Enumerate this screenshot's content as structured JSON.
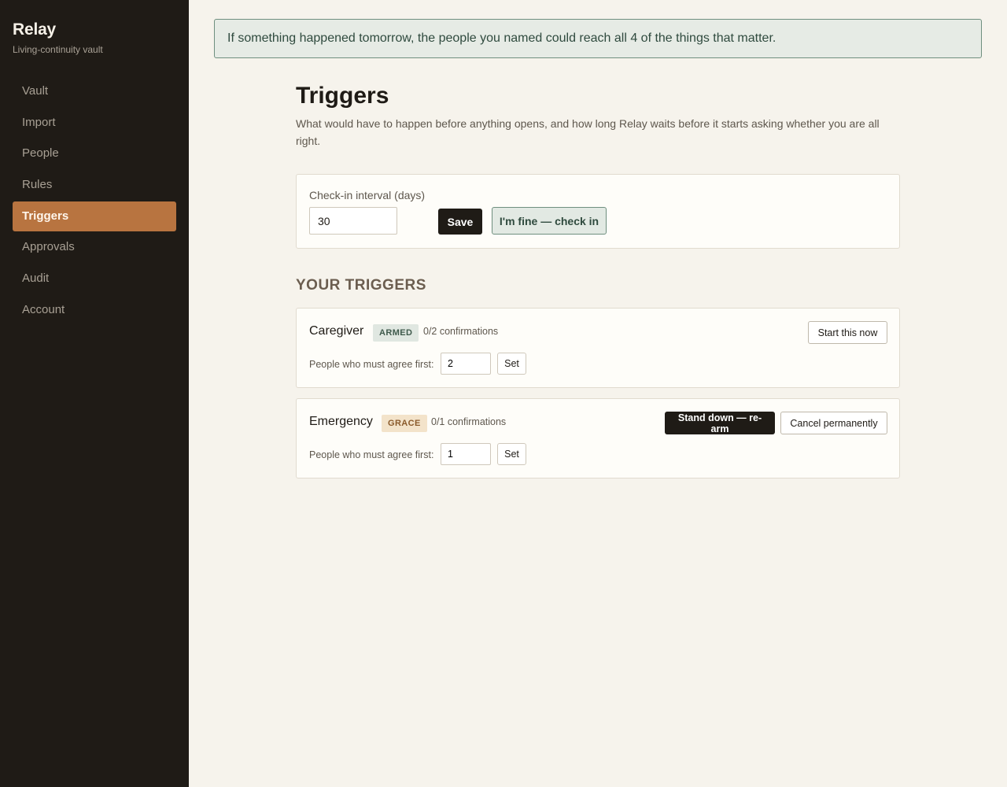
{
  "brand": {
    "name": "Relay",
    "tagline": "Living-continuity vault"
  },
  "nav": {
    "items": [
      {
        "label": "Vault",
        "active": false
      },
      {
        "label": "Import",
        "active": false
      },
      {
        "label": "People",
        "active": false
      },
      {
        "label": "Rules",
        "active": false
      },
      {
        "label": "Triggers",
        "active": true
      },
      {
        "label": "Approvals",
        "active": false
      },
      {
        "label": "Audit",
        "active": false
      },
      {
        "label": "Account",
        "active": false
      }
    ]
  },
  "banner": {
    "text": "If something happened tomorrow, the people you named could reach all 4 of the things that matter."
  },
  "page": {
    "title": "Triggers",
    "subtitle": "What would have to happen before anything opens, and how long Relay waits before it starts asking whether you are all right."
  },
  "interval": {
    "label": "Check-in interval (days)",
    "value": "30",
    "save_label": "Save",
    "checkin_label": "I'm fine — check in"
  },
  "triggers_section": {
    "title": "YOUR TRIGGERS"
  },
  "triggers": [
    {
      "name": "Caregiver",
      "status": "ARMED",
      "confirmations": "0/2 confirmations",
      "agree_label": "People who must agree first:",
      "agree_value": "2",
      "set_label": "Set",
      "start_label": "Start this now"
    },
    {
      "name": "Emergency",
      "status": "GRACE",
      "confirmations": "0/1 confirmations",
      "agree_label": "People who must agree first:",
      "agree_value": "1",
      "set_label": "Set",
      "standdown_label": "Stand down — re-arm",
      "cancel_label": "Cancel permanently"
    }
  ],
  "colors": {
    "sidebar_bg": "#1f1b16",
    "accent": "#b87440",
    "page_bg": "#f6f3ec",
    "banner_border": "#6f8f7f",
    "banner_bg": "#e6ebe5"
  }
}
